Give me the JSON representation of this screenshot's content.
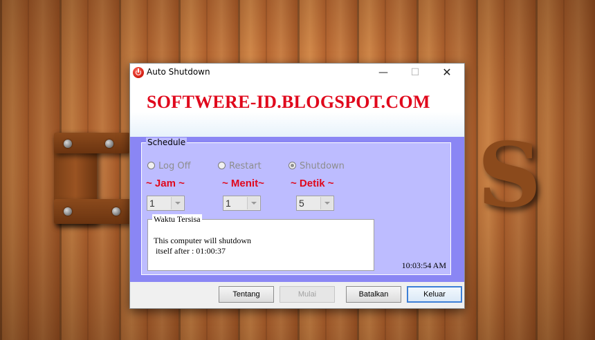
{
  "window": {
    "title": "Auto Shutdown",
    "minimize_glyph": "—",
    "maximize_glyph": "☐",
    "close_glyph": "✕"
  },
  "banner": {
    "text": "SOFTWERE-ID.BLOGSPOT.COM"
  },
  "schedule": {
    "legend": "Schedule",
    "options": [
      {
        "label": "Log Off",
        "selected": false
      },
      {
        "label": "Restart",
        "selected": false
      },
      {
        "label": "Shutdown",
        "selected": true
      }
    ],
    "units": {
      "hours": {
        "label": "~ Jam ~",
        "value": "1"
      },
      "minutes": {
        "label": "~ Menit~",
        "value": "1"
      },
      "seconds": {
        "label": "~ Detik ~",
        "value": "5"
      }
    }
  },
  "remaining": {
    "legend": "Waktu Tersisa",
    "message": "This computer will shutdown\n itself after : 01:00:37"
  },
  "clock": "10:03:54 AM",
  "buttons": {
    "about": "Tentang",
    "start": "Mulai",
    "cancel": "Batalkan",
    "exit": "Keluar"
  },
  "colors": {
    "accent_red": "#e0081c",
    "schedule_bg": "#8a86f4",
    "schedule_inner": "#bdbcff"
  },
  "background": {
    "logo_letter": "S"
  }
}
